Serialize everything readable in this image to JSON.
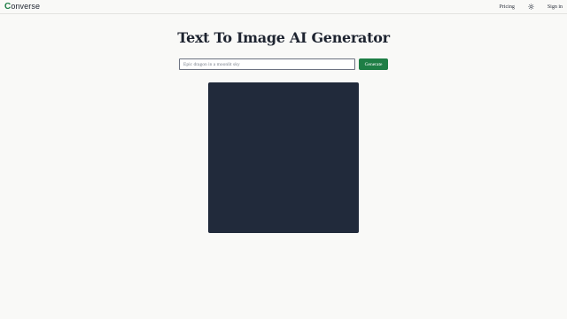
{
  "header": {
    "logo_initial": "C",
    "logo_text": "onverse",
    "nav": {
      "pricing_label": "Pricing",
      "theme_toggle_icon": "sun-icon",
      "sign_in_label": "Sign in"
    }
  },
  "main": {
    "title": "Text To Image AI Generator",
    "prompt": {
      "placeholder": "Epic dragon in a moonlit sky",
      "value": ""
    },
    "generate_label": "Generate",
    "image_preview": {
      "state": "empty"
    }
  },
  "colors": {
    "brand": "#1e7e45",
    "background": "#f9f9f7",
    "canvas": "#212a3b"
  }
}
